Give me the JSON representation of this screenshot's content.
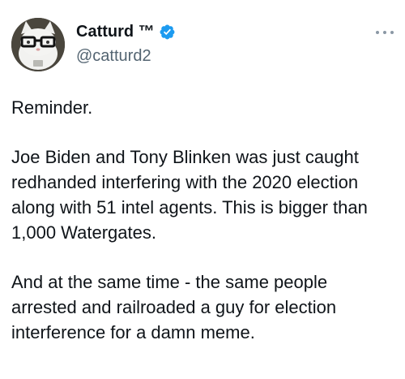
{
  "tweet": {
    "author": {
      "display_name": "Catturd ™",
      "handle": "@catturd2",
      "verified": true,
      "verified_color": "#1d9bf0"
    },
    "more_icon": "more-horizontal-icon",
    "paragraphs": [
      {
        "lines": [
          "Reminder."
        ]
      },
      {
        "lines": [
          "Joe Biden and Tony Blinken was just caught",
          "redhanded interfering with the 2020 election",
          "along with 51 intel agents. This is bigger than",
          "1,000 Watergates."
        ]
      },
      {
        "lines": [
          "And at the same time - the same people",
          "arrested and railroaded a guy for election",
          "interference for a damn meme."
        ]
      }
    ]
  }
}
